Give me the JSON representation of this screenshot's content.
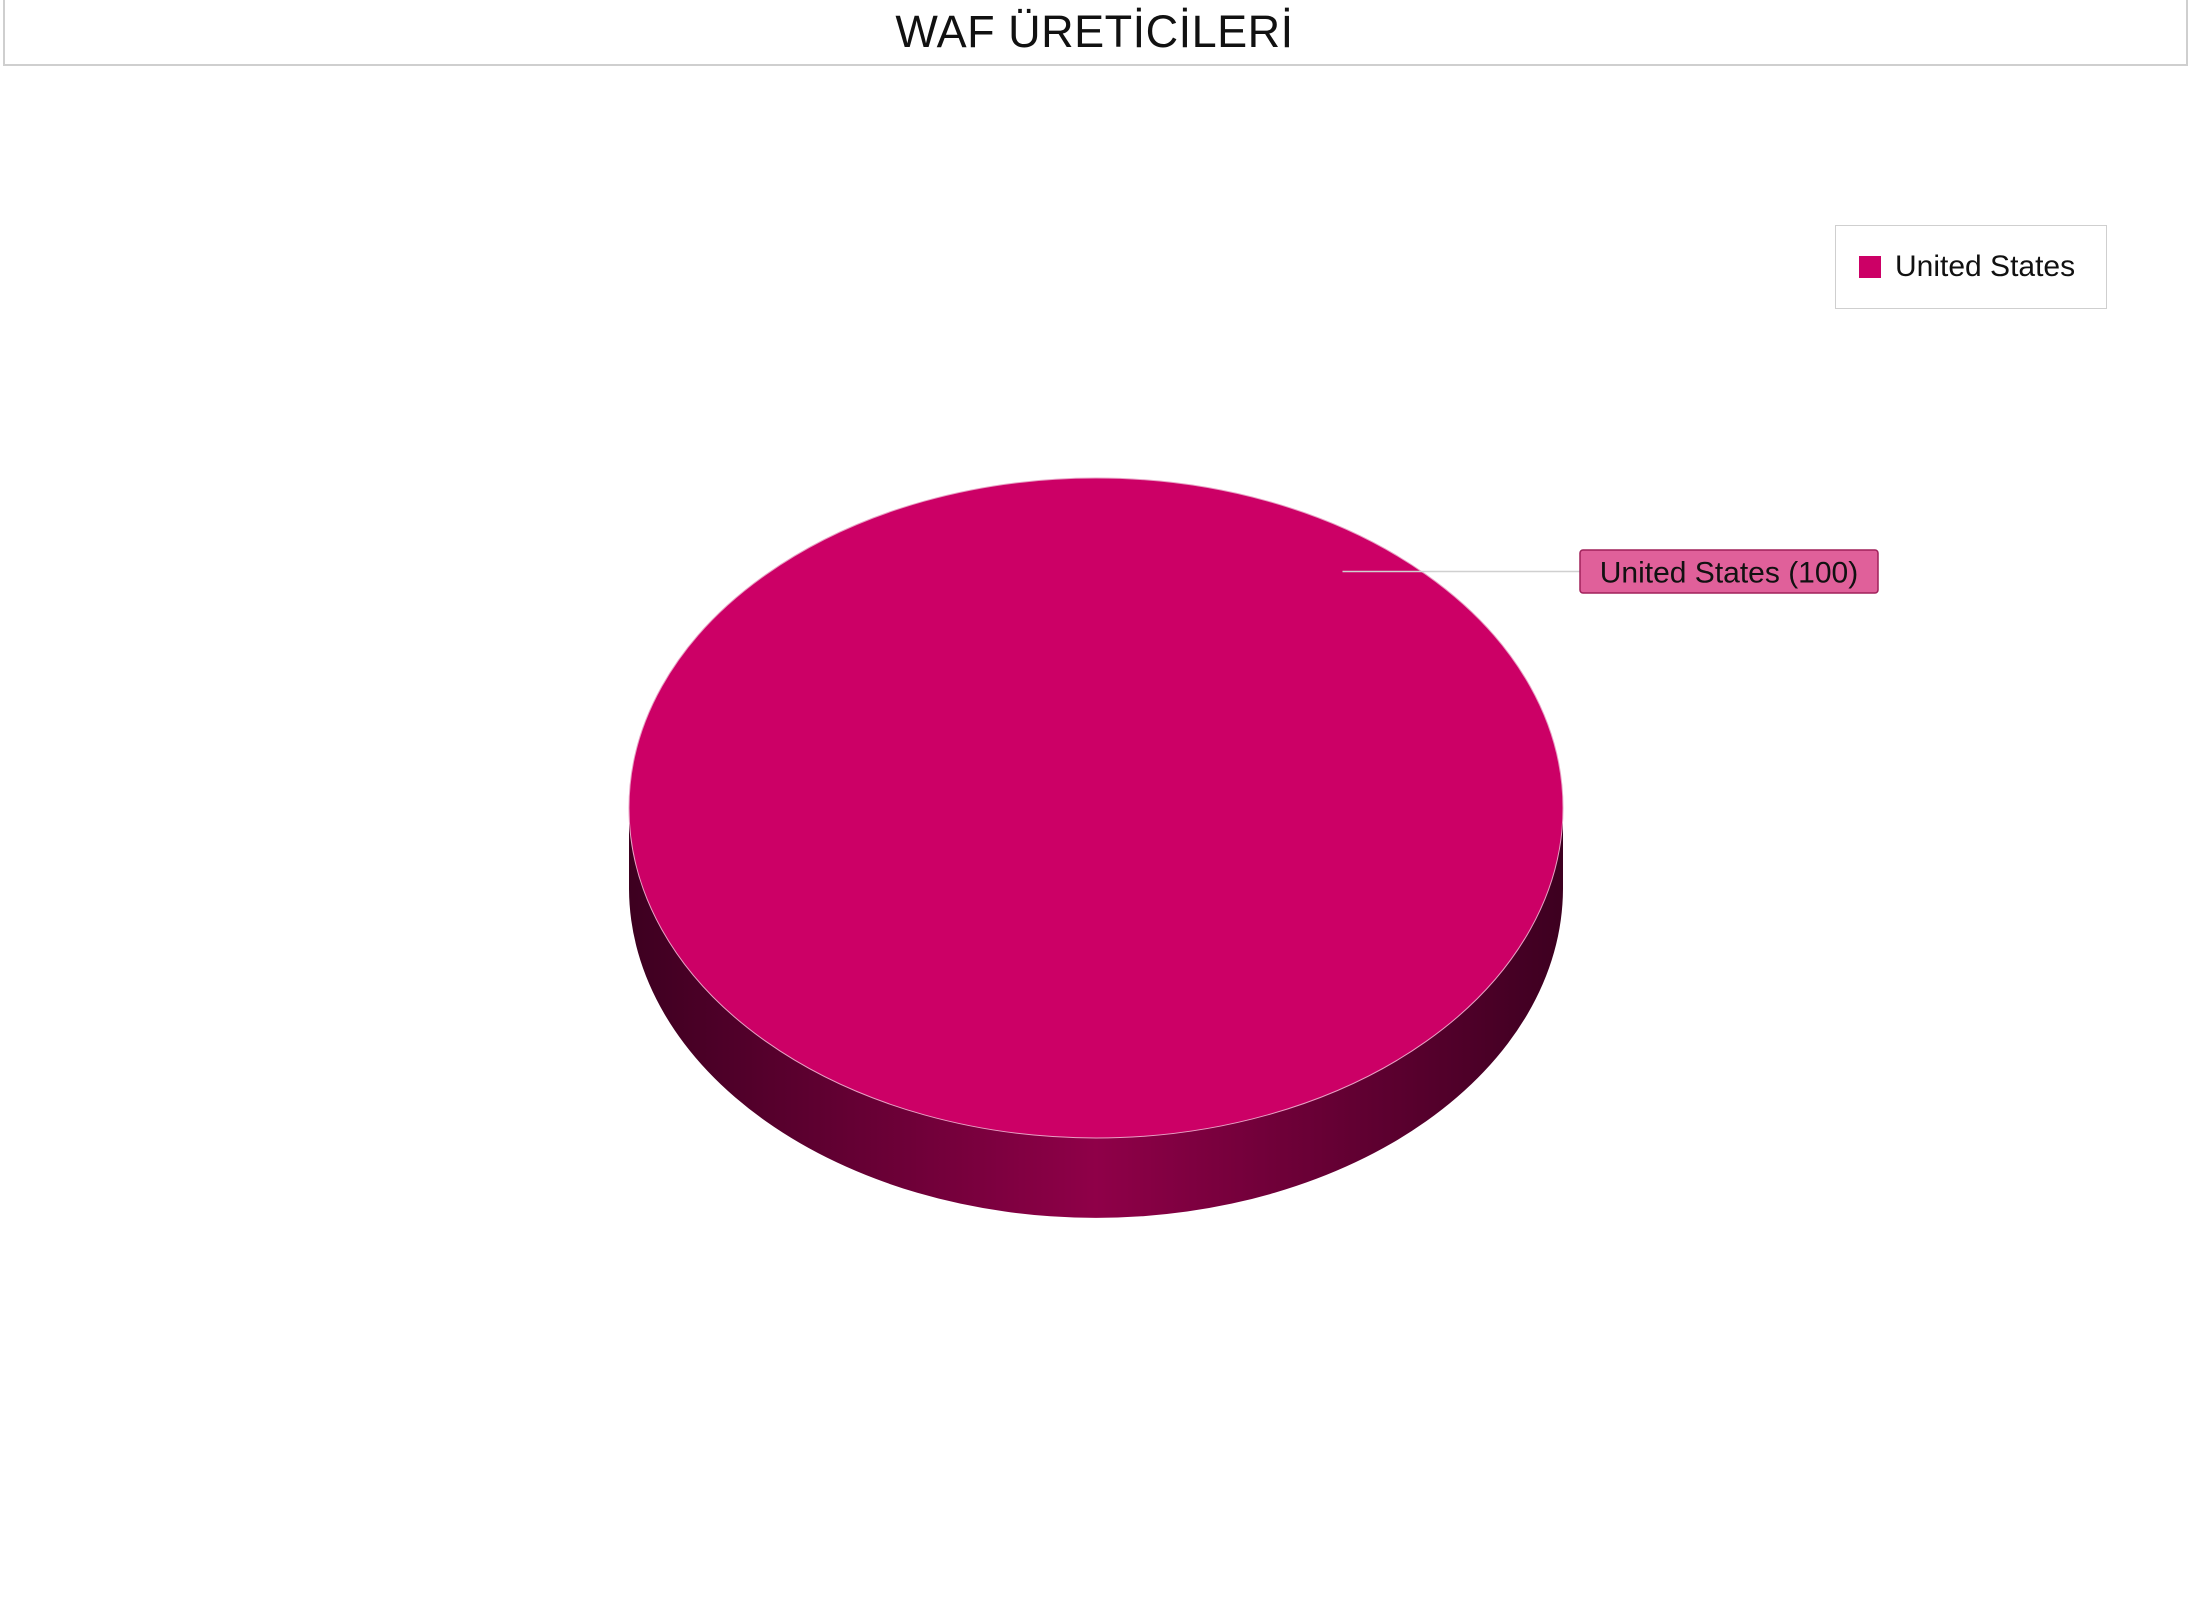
{
  "chart_data": {
    "type": "pie",
    "title": "WAF ÜRETİCİLERİ",
    "three_d": true,
    "legend_position": "top-right",
    "slices": [
      {
        "label": "United States",
        "value": 100,
        "data_label": "United States (100)",
        "color": "#cc0066"
      }
    ]
  },
  "colors": {
    "slice": "#cc0066",
    "slice_side_dark": "#3d0020",
    "slice_side_mid": "#8f0048",
    "label_fill": "#e0609a",
    "label_border": "#a0205a",
    "connector": "#d0d0d0"
  }
}
